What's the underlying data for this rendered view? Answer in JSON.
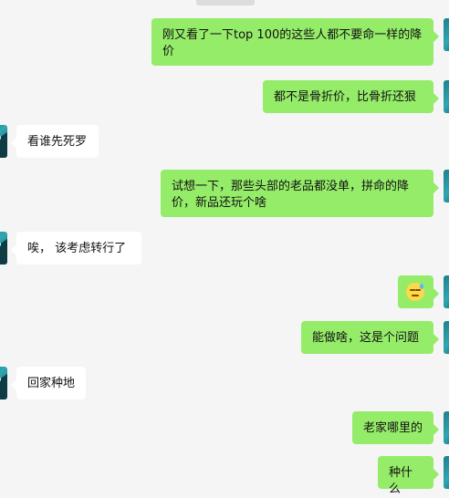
{
  "chat": {
    "messages": [
      {
        "from": "me",
        "text": "刚又看了一下top 100的这些人都不要命一样的降价"
      },
      {
        "from": "me",
        "text": "都不是骨折价，比骨折还狠"
      },
      {
        "from": "other",
        "text": "看谁先死罗"
      },
      {
        "from": "me",
        "text": "试想一下，那些头部的老品都没单，拼命的降价，新品还玩个啥"
      },
      {
        "from": "other",
        "text": "唉， 该考虑转行了"
      },
      {
        "from": "me",
        "emoji": "sweat-smile-emoji"
      },
      {
        "from": "me",
        "text": "能做啥，这是个问题"
      },
      {
        "from": "other",
        "text": "回家种地"
      },
      {
        "from": "me",
        "text": "老家哪里的"
      },
      {
        "from": "me",
        "text": "种什么"
      }
    ]
  },
  "colors": {
    "background": "#f5f5f5",
    "my_bubble": "#95ec69",
    "other_bubble": "#ffffff",
    "avatar": "#1e7f8a"
  },
  "icons": {
    "avatar": "avatar-image",
    "emoji": "sweat-smile-emoji"
  }
}
